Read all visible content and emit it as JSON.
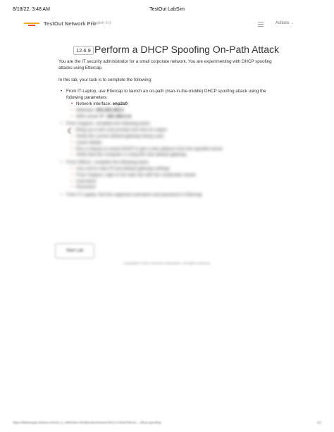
{
  "print_header": {
    "date": "8/18/22, 3:48 AM",
    "title": "TestOut LabSim"
  },
  "topbar": {
    "brand": "TestOut Network Pro",
    "edition": "English 6.0",
    "actions_label": "Actions"
  },
  "lab": {
    "section": "12.6.9",
    "title": "Perform a DHCP Spoofing On-Path Attack",
    "intro": "You are the IT security administrator for a small corporate network. You are experimenting with DHCP spoofing attacks using Ettercap.",
    "task_intro": "In this lab, your task is to complete the following:",
    "step1": "From IT-Laptop, use Ettercap to launch an on-path (man-in-the-middle) DHCP spoofing attack using the following parameters:",
    "step1_params": {
      "iface_label": "Network interface:",
      "iface_value": "enp2s0",
      "netmask_label": "Netmask:",
      "netmask_value": "255.255.255.0",
      "dns_label": "DNS server IP:",
      "dns_value": "192.168.0.11"
    },
    "blurred_steps": [
      "From Support, complete the following tasks:",
      "Bring up a new cmd prompt and view its output",
      "Verify the current default gateway being used",
      "Lease details",
      "Run a release & renew DHCP to get a new address from the spoofed server",
      "Verify that the computer is using the new default gateway",
      "From Office1, complete the following tasks:",
      "Use cmd to view IP and default gateway settings",
      "From Support, login to the web site with the credentials shown",
      "Username",
      "Password",
      "From IT-Laptop, find the captured username and password in Ettercap"
    ],
    "start_label": "Start Lab"
  },
  "copyright": "Copyright © 2022 TestOut Corporation. All rights reserved.",
  "print_footer": {
    "url": "https://labsimapp.testout.com/v6_0_498/index.html/productviewer/15/12.6.9/3a7b8c2e-.../dhcp-spoofing",
    "page": "1/2"
  }
}
